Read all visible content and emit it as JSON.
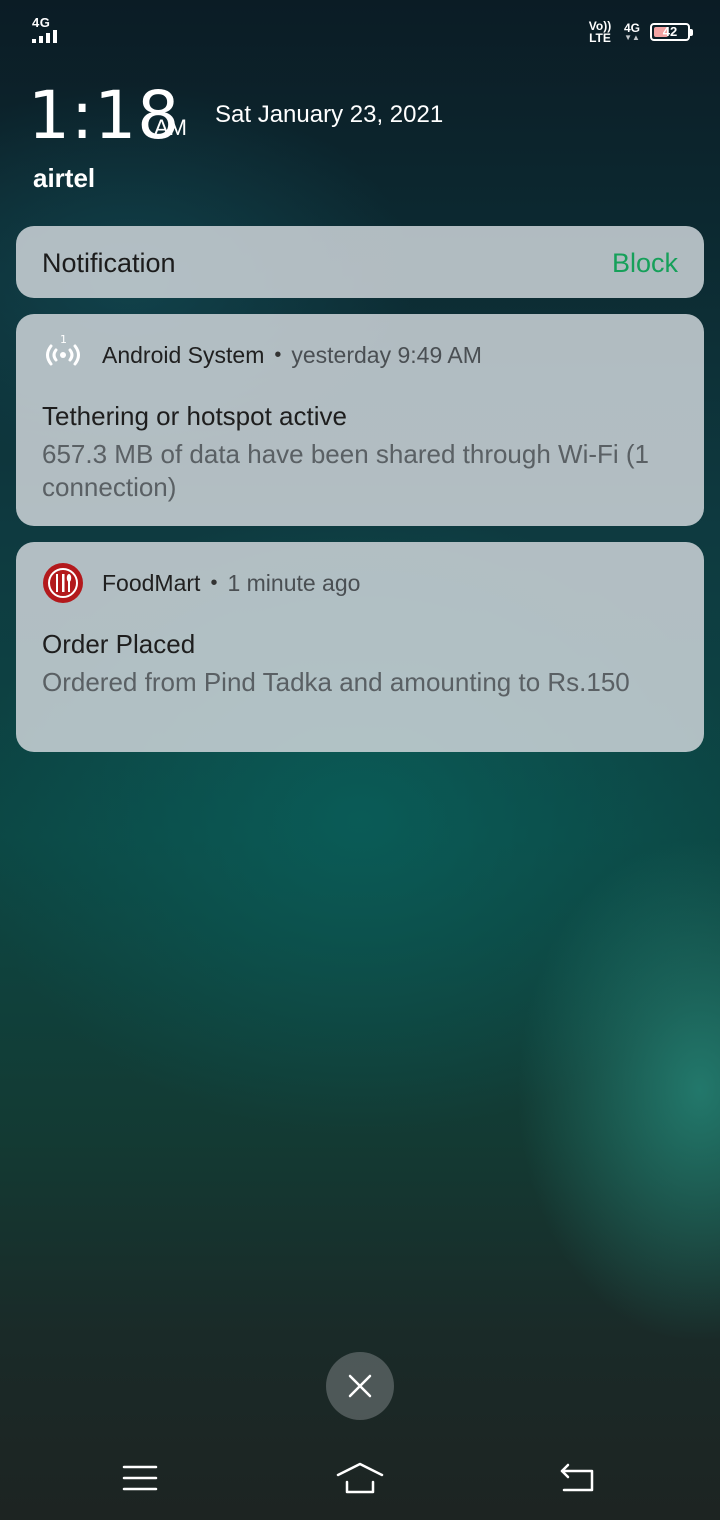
{
  "status_bar": {
    "network_left": "4G",
    "volte_top": "Vo))",
    "volte_bottom": "LTE",
    "network_right": "4G",
    "battery_level": "42"
  },
  "lock_screen": {
    "time": "1:18",
    "ampm": "AM",
    "date": "Sat January 23, 2021",
    "carrier": "airtel"
  },
  "notification_header": {
    "title": "Notification",
    "block_label": "Block"
  },
  "notifications": [
    {
      "app": "Android System",
      "separator": "•",
      "time": "yesterday 9:49 AM",
      "title": "Tethering or hotspot active",
      "body": "657.3 MB of data have been shared through Wi-Fi (1 connection)",
      "icon": "hotspot-icon"
    },
    {
      "app": "FoodMart",
      "separator": "•",
      "time": "1 minute ago",
      "title": "Order Placed",
      "body": "Ordered from Pind Tadka and amounting to Rs.150",
      "icon": "foodmart-logo-icon"
    }
  ],
  "colors": {
    "block_accent": "#16a05a",
    "foodmart_red": "#b3191c"
  },
  "nav": {
    "icons": [
      "menu-icon",
      "home-icon",
      "back-icon"
    ]
  }
}
